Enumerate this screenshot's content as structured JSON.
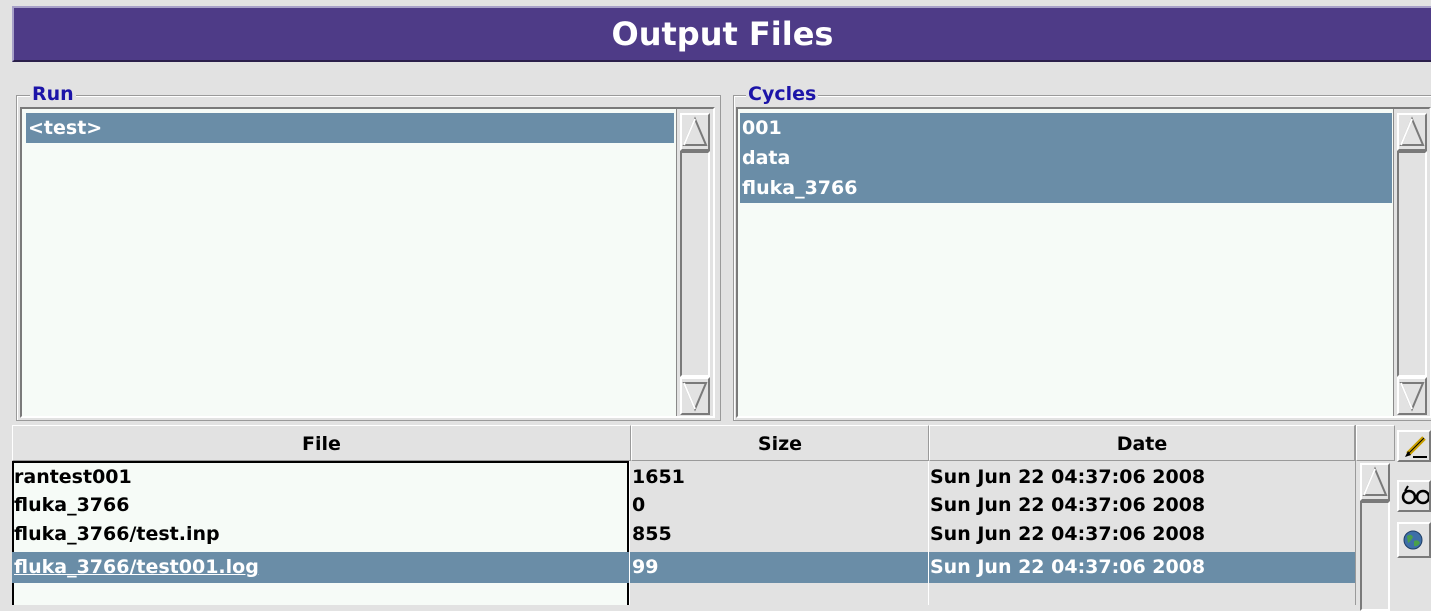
{
  "window": {
    "title": "Output Files"
  },
  "run_group": {
    "title": "Run",
    "items": [
      "<test>"
    ]
  },
  "cycles_group": {
    "title": "Cycles",
    "items": [
      "001",
      "data",
      "fluka_3766"
    ]
  },
  "files_table": {
    "columns": [
      "File",
      "Size",
      "Date"
    ],
    "rows": [
      {
        "file": "rantest001",
        "size": "1651",
        "date": "Sun Jun 22 04:37:06 2008"
      },
      {
        "file": "fluka_3766",
        "size": "0",
        "date": "Sun Jun 22 04:37:06 2008"
      },
      {
        "file": "fluka_3766/test.inp",
        "size": "855",
        "date": "Sun Jun 22 04:37:06 2008"
      },
      {
        "file": "fluka_3766/test001.log",
        "size": "99",
        "date": "Sun Jun 22 04:37:06 2008"
      }
    ],
    "selected_row": 3
  },
  "toolbar": {
    "icons": [
      "edit-pencil-icon",
      "view-glasses-icon",
      "process-globe-icon"
    ]
  },
  "colors": {
    "title_bar": "#4e3b87",
    "selection": "#6a8da7",
    "group_title": "#1c14a8",
    "list_background": "#f6fbf7",
    "window_background": "#e2e2e2"
  }
}
